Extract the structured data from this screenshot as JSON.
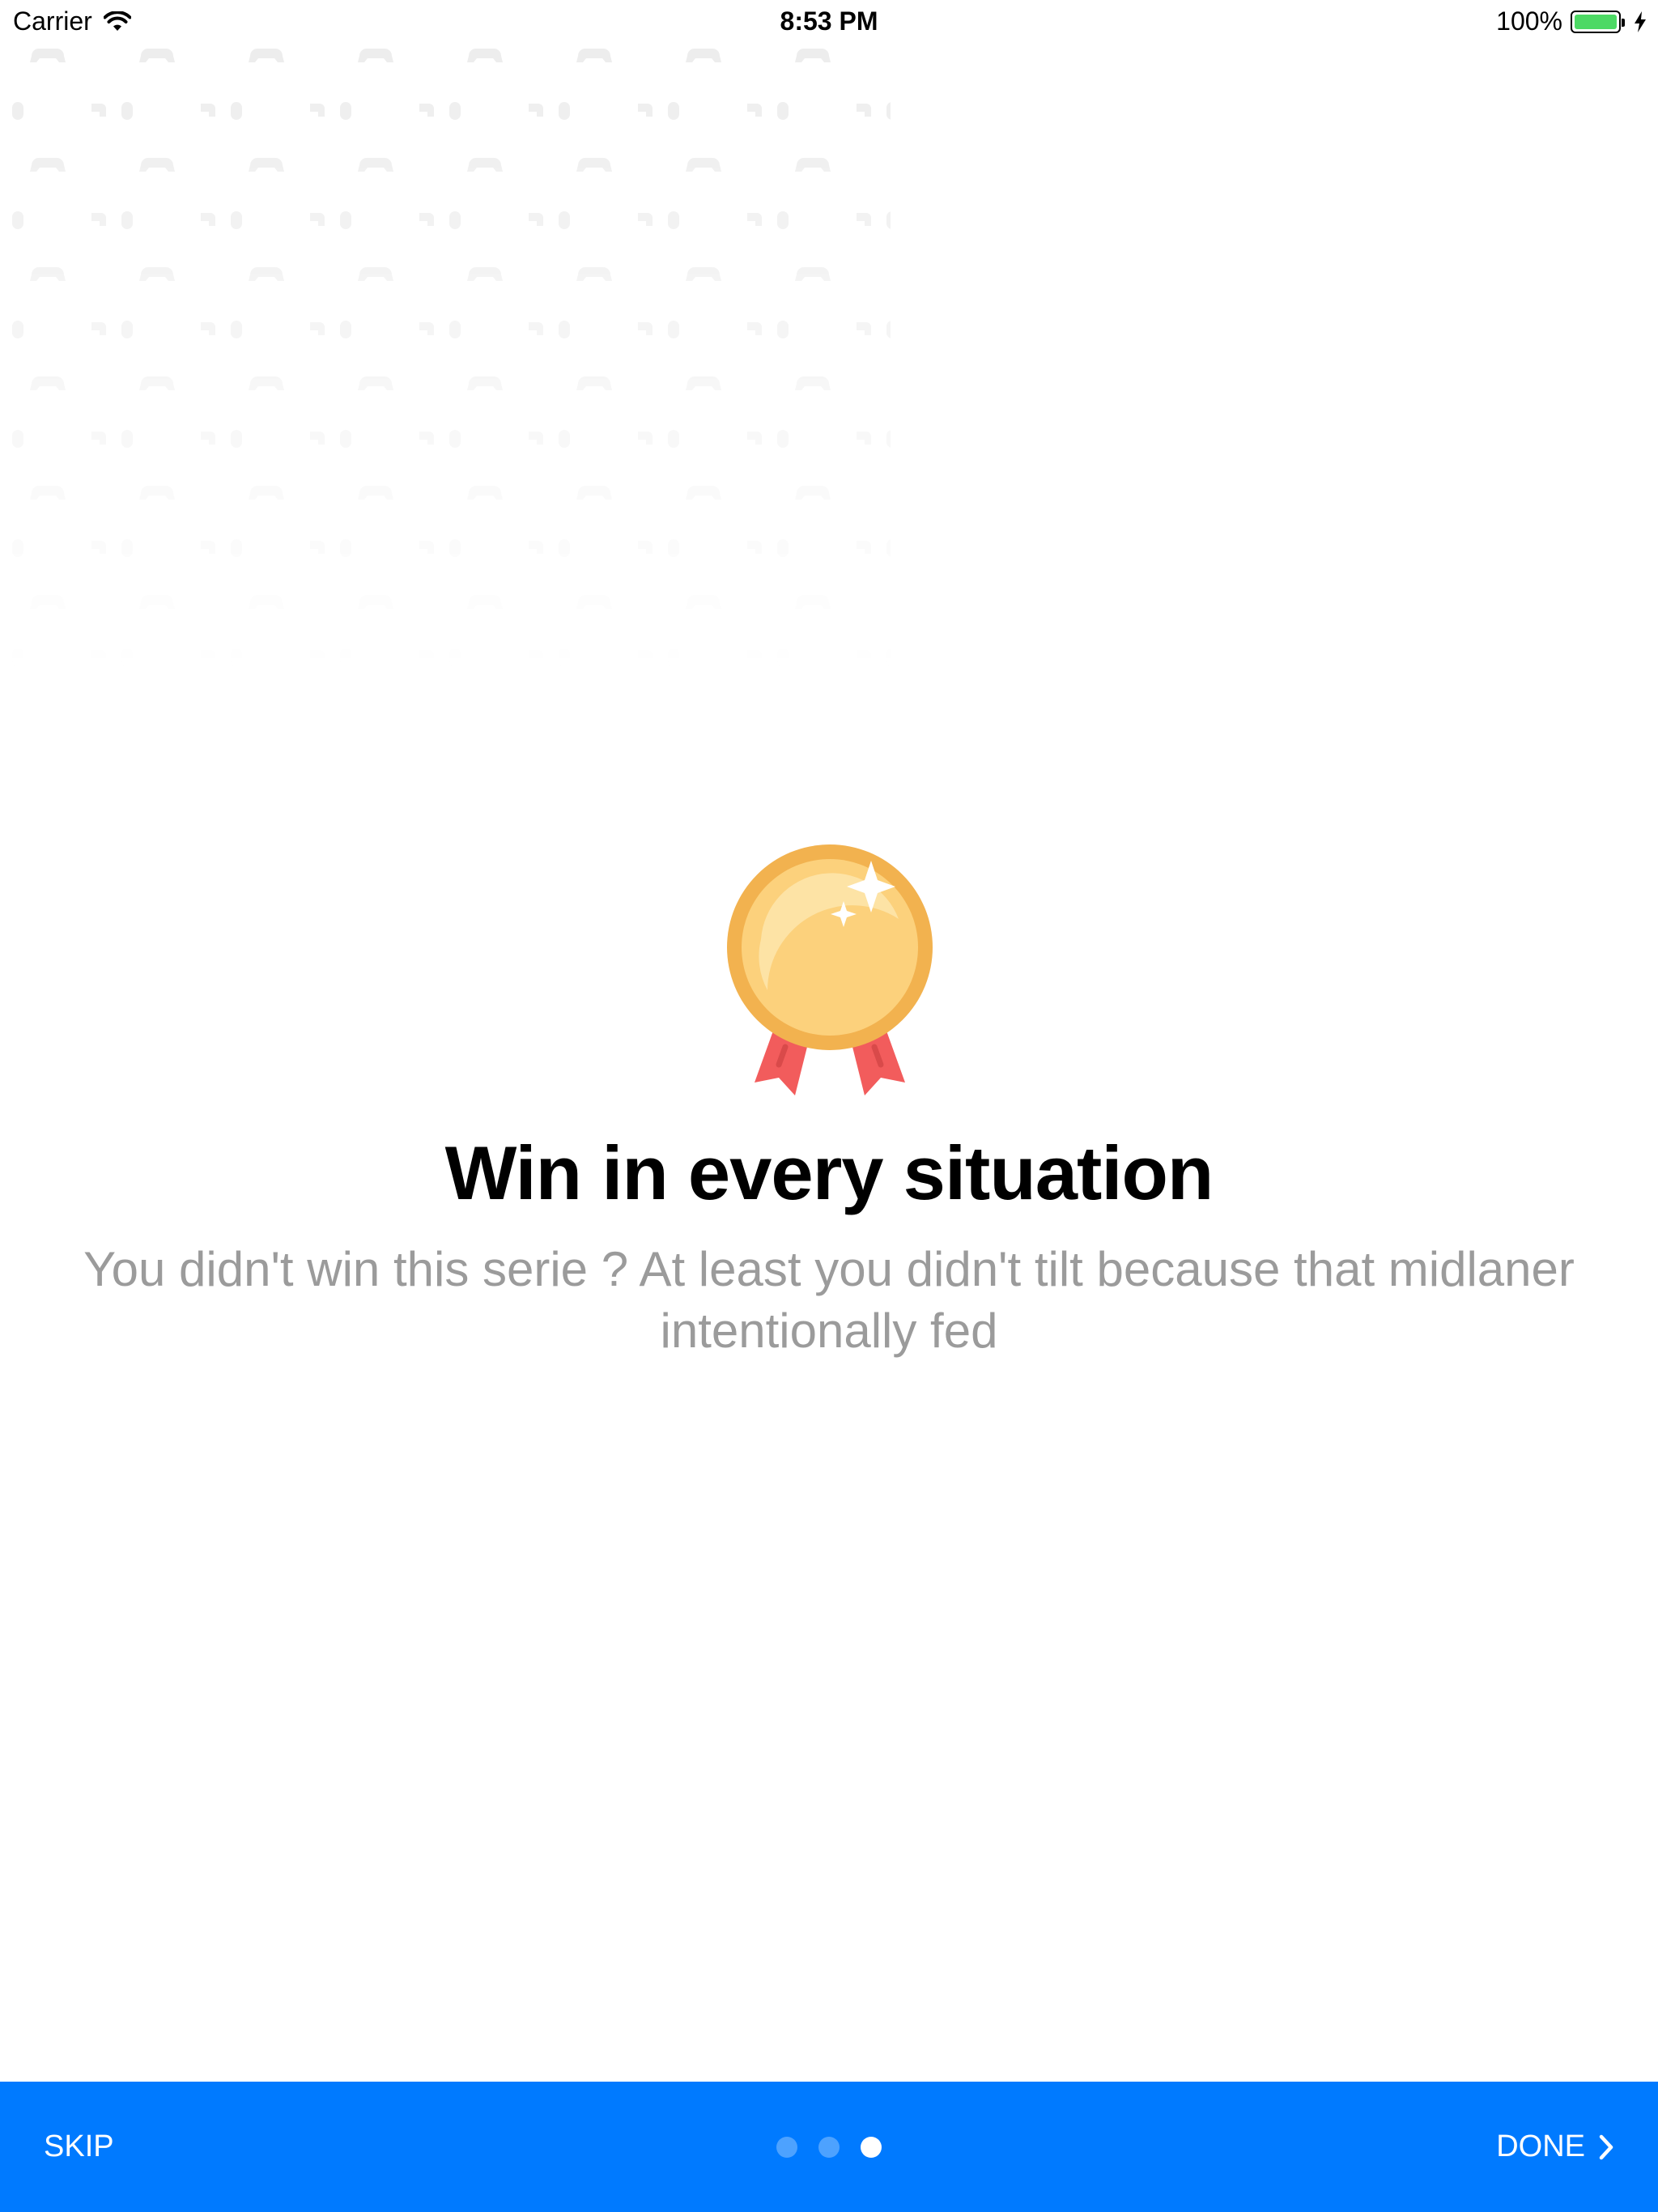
{
  "status_bar": {
    "carrier": "Carrier",
    "time": "8:53 PM",
    "battery_percent": "100%",
    "battery_level": 1.0,
    "battery_color": "#4cd964"
  },
  "onboarding": {
    "icon": "medal-icon",
    "title": "Win in every situation",
    "description": "You didn't win this serie ? At least you didn't tilt because that midlaner intentionally fed"
  },
  "bottom_bar": {
    "background": "#007aff",
    "skip_label": "SKIP",
    "done_label": "DONE",
    "page_count": 3,
    "current_page": 3
  }
}
